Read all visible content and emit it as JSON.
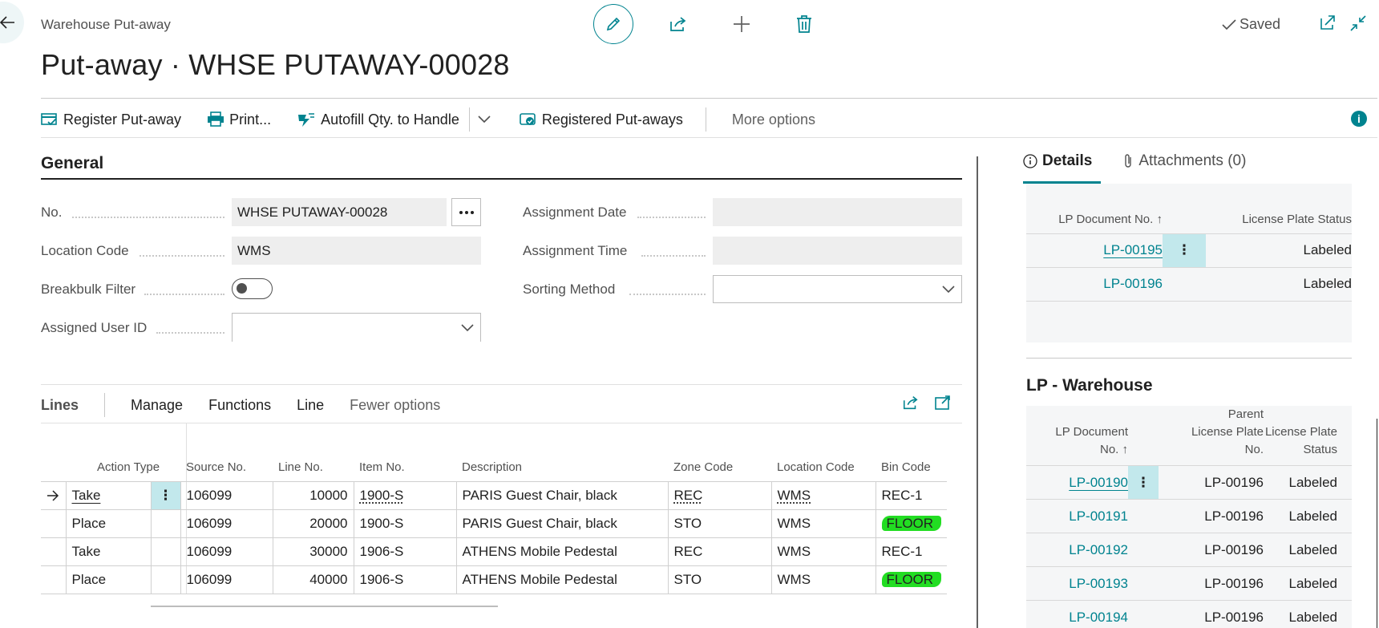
{
  "header": {
    "breadcrumb": "Warehouse Put-away",
    "title": "Put-away · WHSE PUTAWAY-00028",
    "saved_label": "Saved"
  },
  "actions": {
    "register": "Register Put-away",
    "print": "Print...",
    "autofill": "Autofill Qty. to Handle",
    "registered": "Registered Put-aways",
    "more": "More options"
  },
  "general": {
    "title": "General",
    "no_label": "No.",
    "no_value": "WHSE PUTAWAY-00028",
    "location_label": "Location Code",
    "location_value": "WMS",
    "breakbulk_label": "Breakbulk Filter",
    "assigned_user_label": "Assigned User ID",
    "assignment_date_label": "Assignment Date",
    "assignment_time_label": "Assignment Time",
    "sorting_label": "Sorting Method"
  },
  "lines": {
    "title": "Lines",
    "menu": [
      "Manage",
      "Functions",
      "Line"
    ],
    "fewer": "Fewer options",
    "columns": {
      "action_type": "Action Type",
      "source_no": "Source No.",
      "line_no": "Line No.",
      "item_no": "Item No.",
      "description": "Description",
      "zone": "Zone Code",
      "location": "Location Code",
      "bin": "Bin Code"
    },
    "rows": [
      {
        "action": "Take",
        "source": "106099",
        "line": "10000",
        "item": "1900-S",
        "desc": "PARIS Guest Chair, black",
        "zone": "REC",
        "loc": "WMS",
        "bin": "REC-1"
      },
      {
        "action": "Place",
        "source": "106099",
        "line": "20000",
        "item": "1900-S",
        "desc": "PARIS Guest Chair, black",
        "zone": "STO",
        "loc": "WMS",
        "bin": "FLOOR"
      },
      {
        "action": "Take",
        "source": "106099",
        "line": "30000",
        "item": "1906-S",
        "desc": "ATHENS Mobile Pedestal",
        "zone": "REC",
        "loc": "WMS",
        "bin": "REC-1"
      },
      {
        "action": "Place",
        "source": "106099",
        "line": "40000",
        "item": "1906-S",
        "desc": "ATHENS Mobile Pedestal",
        "zone": "STO",
        "loc": "WMS",
        "bin": "FLOOR"
      }
    ]
  },
  "factbox": {
    "tab_details": "Details",
    "tab_attachments": "Attachments (0)",
    "details": {
      "col_doc": "LP Document No. ↑",
      "col_status": "License Plate Status",
      "rows": [
        {
          "doc": "LP-00195",
          "status": "Labeled"
        },
        {
          "doc": "LP-00196",
          "status": "Labeled"
        }
      ]
    },
    "warehouse": {
      "title": "LP - Warehouse",
      "col_doc_1": "LP Document",
      "col_doc_2": "No. ↑",
      "col_parent_1": "Parent",
      "col_parent_2": "License Plate",
      "col_parent_3": "No.",
      "col_status_1": "License Plate",
      "col_status_2": "Status",
      "rows": [
        {
          "doc": "LP-00190",
          "parent": "LP-00196",
          "status": "Labeled"
        },
        {
          "doc": "LP-00191",
          "parent": "LP-00196",
          "status": "Labeled"
        },
        {
          "doc": "LP-00192",
          "parent": "LP-00196",
          "status": "Labeled"
        },
        {
          "doc": "LP-00193",
          "parent": "LP-00196",
          "status": "Labeled"
        },
        {
          "doc": "LP-00194",
          "parent": "LP-00196",
          "status": "Labeled"
        }
      ]
    }
  },
  "colors": {
    "accent": "#00838f",
    "highlight": "#22dd22",
    "row_menu": "#c2e8ec"
  }
}
